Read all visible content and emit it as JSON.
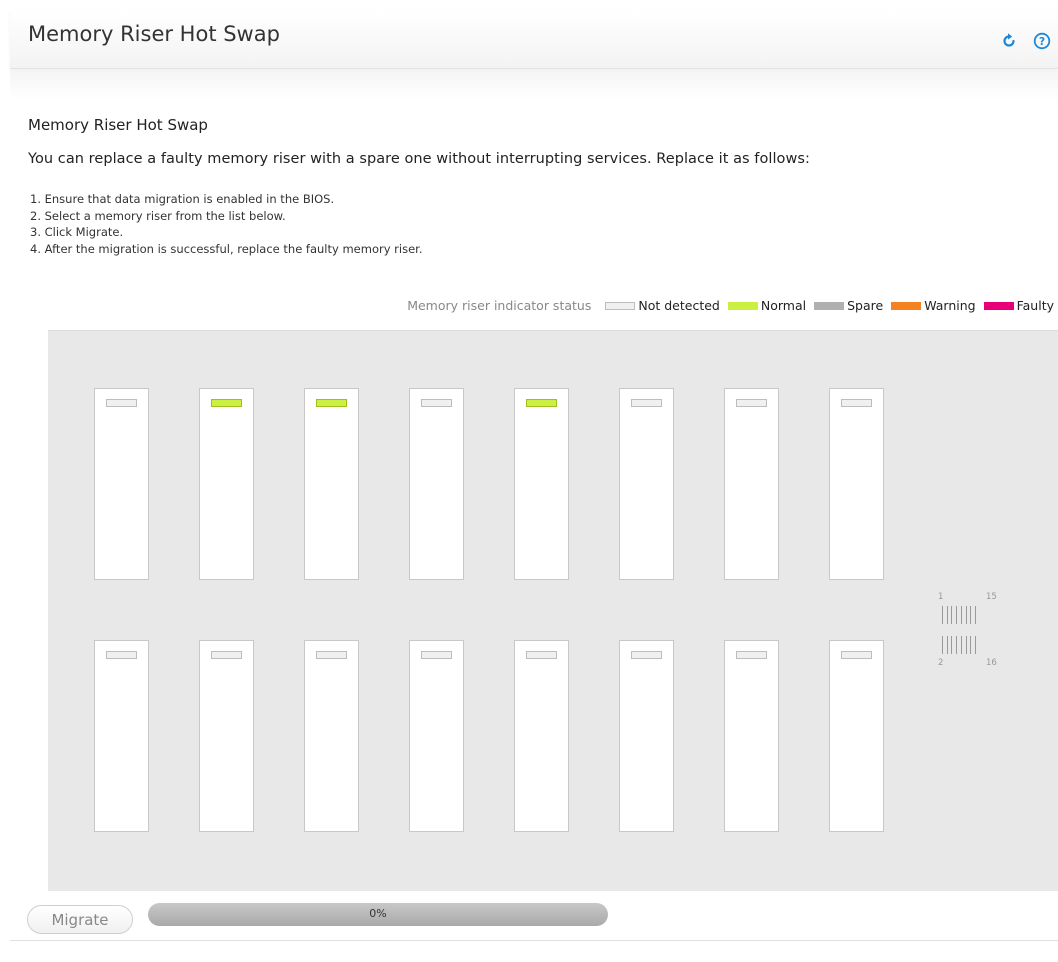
{
  "header": {
    "title": "Memory Riser Hot Swap",
    "refresh_icon": "refresh-icon",
    "help_icon": "help-icon"
  },
  "section": {
    "title": "Memory Riser Hot Swap",
    "intro": "You can replace a faulty memory riser with a spare one without interrupting services. Replace it as follows:",
    "steps": [
      "1. Ensure that data migration is enabled in the BIOS.",
      "2. Select a memory riser from the list below.",
      "3. Click Migrate.",
      "4. After the migration is successful, replace the faulty memory riser."
    ]
  },
  "legend": {
    "caption": "Memory riser indicator status",
    "items": [
      {
        "label": "Not detected",
        "color": "#f0f0f0"
      },
      {
        "label": "Normal",
        "color": "#ccf042"
      },
      {
        "label": "Spare",
        "color": "#b0b0b0"
      },
      {
        "label": "Warning",
        "color": "#f58220"
      },
      {
        "label": "Faulty",
        "color": "#e8007a"
      }
    ]
  },
  "risers": {
    "top_row": [
      "not-detected",
      "normal",
      "normal",
      "not-detected",
      "normal",
      "not-detected",
      "not-detected",
      "not-detected"
    ],
    "bottom_row": [
      "not-detected",
      "not-detected",
      "not-detected",
      "not-detected",
      "not-detected",
      "not-detected",
      "not-detected",
      "not-detected"
    ]
  },
  "mini_map": {
    "top_left": "1",
    "top_right": "15",
    "bottom_left": "2",
    "bottom_right": "16"
  },
  "actions": {
    "migrate_label": "Migrate",
    "progress_percent": 0,
    "progress_text": "0%"
  }
}
